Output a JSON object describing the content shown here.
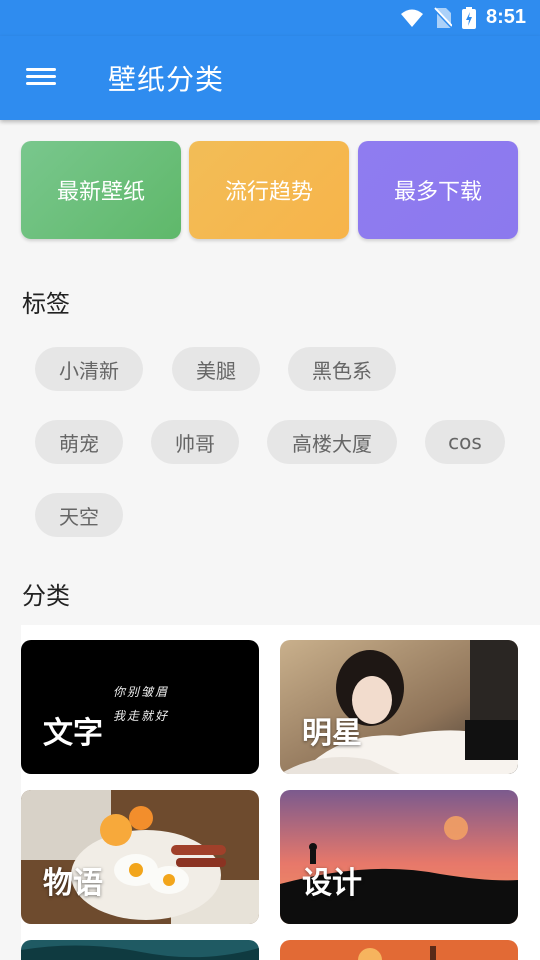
{
  "status": {
    "time": "8:51"
  },
  "appbar": {
    "title": "壁纸分类"
  },
  "quick": [
    "最新壁纸",
    "流行趋势",
    "最多下载"
  ],
  "tags_title": "标签",
  "tags": [
    "小清新",
    "美腿",
    "黑色系",
    "萌宠",
    "帅哥",
    "高楼大厦",
    "cos",
    "天空"
  ],
  "categories_title": "分类",
  "categories": [
    {
      "label": "文字",
      "quote_line1": "你别皱眉",
      "quote_line2": "我走就好"
    },
    {
      "label": "明星"
    },
    {
      "label": "物语"
    },
    {
      "label": "设计"
    }
  ],
  "colors": {
    "primary": "#2f8cef",
    "green": "#66bb73",
    "orange": "#f6b94f",
    "purple": "#8d7aef"
  }
}
